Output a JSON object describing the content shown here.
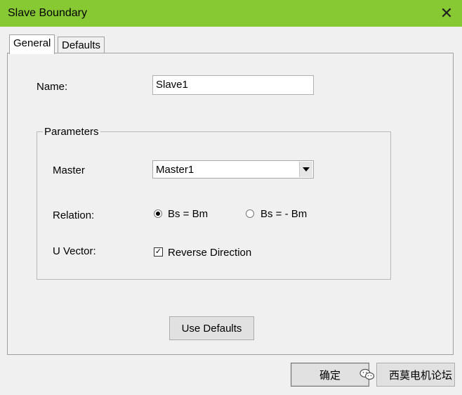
{
  "window": {
    "title": "Slave Boundary",
    "close_glyph": "✕"
  },
  "tabs": [
    {
      "label": "General",
      "active": true
    },
    {
      "label": "Defaults",
      "active": false
    }
  ],
  "general": {
    "name_label": "Name:",
    "name_value": "Slave1",
    "parameters_group": "Parameters",
    "master_label": "Master",
    "master_selected": "Master1",
    "relation_label": "Relation:",
    "relation_options": [
      {
        "label": "Bs = Bm",
        "selected": true
      },
      {
        "label": "Bs = - Bm",
        "selected": false
      }
    ],
    "uvector_label": "U Vector:",
    "reverse_direction_label": "Reverse Direction",
    "reverse_direction_checked": true,
    "use_defaults_label": "Use Defaults"
  },
  "footer": {
    "ok_label": "确定",
    "cancel_label": "西莫电机论坛"
  },
  "icons": {
    "close": "close-icon",
    "dropdown": "chevron-down-icon",
    "watermark": "wechat-icon"
  },
  "colors": {
    "titlebar": "#86c932",
    "dialog_bg": "#f0f0f0",
    "button_bg": "#e1e1e1"
  }
}
